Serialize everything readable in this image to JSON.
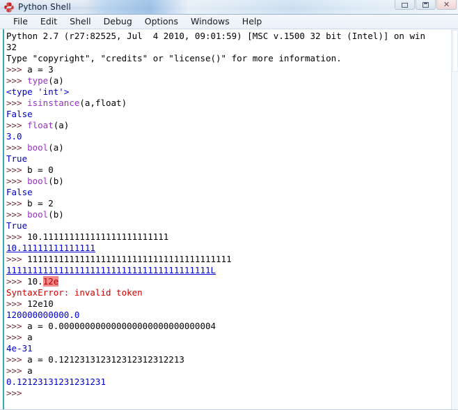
{
  "window": {
    "title": "Python Shell",
    "icon": "python-logo-icon",
    "controls": [
      {
        "name": "minimize-button",
        "glyph": "minimize-icon"
      },
      {
        "name": "maximize-button",
        "glyph": "maximize-icon"
      },
      {
        "name": "close-button",
        "glyph": "close-icon",
        "label": "✕"
      }
    ]
  },
  "menubar": {
    "items": [
      {
        "label": "File"
      },
      {
        "label": "Edit"
      },
      {
        "label": "Shell"
      },
      {
        "label": "Debug"
      },
      {
        "label": "Options"
      },
      {
        "label": "Windows"
      },
      {
        "label": "Help"
      }
    ]
  },
  "console": {
    "prompt": ">>> ",
    "colors": {
      "prompt": "#7a2b3a",
      "builtin": "#9b30c8",
      "output": "#0000cc",
      "error": "#cc0000",
      "error_highlight_bg": "#f58a8a",
      "cursor_bar": "#3aa6b9"
    },
    "lines": [
      {
        "type": "banner",
        "text": "Python 2.7 (r27:82525, Jul  4 2010, 09:01:59) [MSC v.1500 32 bit (Intel)] on win"
      },
      {
        "type": "banner",
        "text": "32"
      },
      {
        "type": "banner",
        "text": "Type \"copyright\", \"credits\" or \"license()\" for more information."
      },
      {
        "type": "input",
        "code": "a = 3"
      },
      {
        "type": "input",
        "builtin": "type",
        "code": "(a)"
      },
      {
        "type": "output",
        "text": "<type 'int'>"
      },
      {
        "type": "input",
        "builtin": "isinstance",
        "code": "(a,float)"
      },
      {
        "type": "output",
        "text": "False"
      },
      {
        "type": "input",
        "builtin": "float",
        "code": "(a)"
      },
      {
        "type": "output",
        "text": "3.0"
      },
      {
        "type": "input",
        "builtin": "bool",
        "code": "(a)"
      },
      {
        "type": "output",
        "text": "True"
      },
      {
        "type": "input",
        "code": "b = 0"
      },
      {
        "type": "input",
        "builtin": "bool",
        "code": "(b)"
      },
      {
        "type": "output",
        "text": "False"
      },
      {
        "type": "input",
        "code": "b = 2"
      },
      {
        "type": "input",
        "builtin": "bool",
        "code": "(b)"
      },
      {
        "type": "output",
        "text": "True"
      },
      {
        "type": "input",
        "code": "10.111111111111111111111111"
      },
      {
        "type": "output_underline",
        "text": "10.11111111111111"
      },
      {
        "type": "input",
        "code": "111111111111111111111111111111111111111"
      },
      {
        "type": "output_underline",
        "text": "111111111111111111111111111111111111111L"
      },
      {
        "type": "input_error",
        "code": "10.",
        "highlight": "12e"
      },
      {
        "type": "error",
        "text": "SyntaxError: invalid token"
      },
      {
        "type": "input",
        "code": "12e10"
      },
      {
        "type": "output",
        "text": "120000000000.0"
      },
      {
        "type": "input",
        "code": "a = 0.000000000000000000000000000004"
      },
      {
        "type": "input",
        "code": "a"
      },
      {
        "type": "output",
        "text": "4e-31"
      },
      {
        "type": "input",
        "code": "a = 0.121231312312312312312213"
      },
      {
        "type": "input",
        "code": "a"
      },
      {
        "type": "output",
        "text": "0.12123131231231231"
      },
      {
        "type": "input",
        "code": ""
      }
    ]
  }
}
